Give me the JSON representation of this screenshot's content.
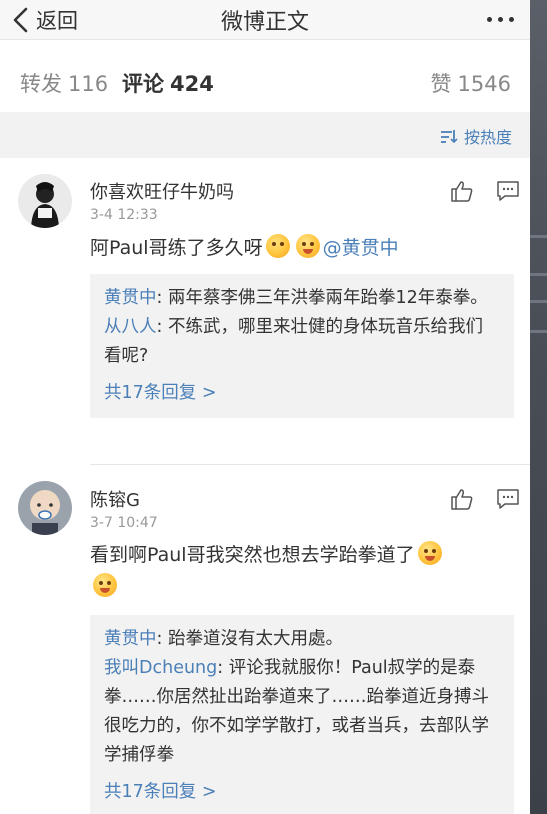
{
  "nav": {
    "back_label": "返回",
    "title": "微博正文"
  },
  "tabs": {
    "repost": {
      "label": "转发",
      "count": "116"
    },
    "comment": {
      "label": "评论",
      "count": "424"
    },
    "like": {
      "label": "赞",
      "count": "1546"
    }
  },
  "sort": {
    "label": "按热度"
  },
  "comments": [
    {
      "user": "你喜欢旺仔牛奶吗",
      "time": "3-4 12:33",
      "text": "阿Paul哥练了多久呀",
      "mention": "@黄贯中",
      "emojis": [
        "kiss-emoji",
        "shy-emoji"
      ],
      "replies": [
        {
          "name": "黄贯中",
          "text": ": 兩年蔡李佛三年洪拳兩年跆拳12年泰拳。"
        },
        {
          "name": "从八人",
          "text": ": 不练武，哪里来壮健的身体玩音乐给我们看呢?"
        }
      ],
      "more": "共17条回复 >"
    },
    {
      "user": "陈镕G",
      "time": "3-7 10:47",
      "text": "看到啊Paul哥我突然也想去学跆拳道了",
      "emojis": [
        "shy-emoji",
        "shy-emoji"
      ],
      "replies": [
        {
          "name": "黄贯中",
          "text": ": 跆拳道沒有太大用處。"
        },
        {
          "name": "我叫Dcheung",
          "text": ": 评论我就服你！Paul叔学的是泰拳……你居然扯出跆拳道来了……跆拳道近身搏斗很吃力的，你不如学学散打，或者当兵，去部队学学捕俘拳"
        }
      ],
      "more": "共17条回复 >"
    }
  ],
  "colors": {
    "link": "#4a7fb8",
    "text": "#333333",
    "muted": "#999999",
    "reply_bg": "#f2f2f2"
  }
}
